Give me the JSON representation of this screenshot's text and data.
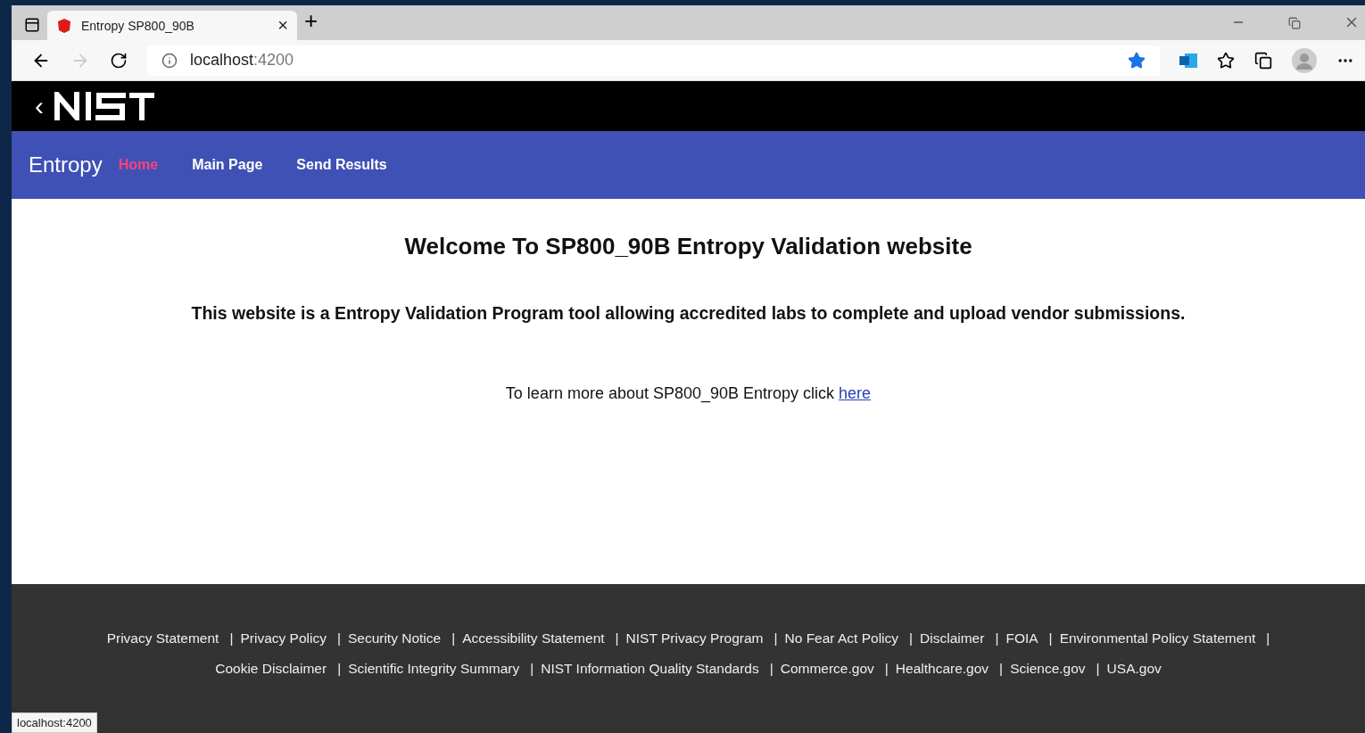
{
  "browser": {
    "tab": {
      "title": "Entropy SP800_90B",
      "close": "×",
      "selected": true
    },
    "new_tab": "+",
    "address": {
      "host": "localhost",
      "port": ":4200"
    },
    "favorite_on": true,
    "status_url": "localhost:4200"
  },
  "header": {
    "back": "‹"
  },
  "navbar": {
    "brand": "Entropy",
    "items": [
      {
        "label": "Home",
        "selected": true
      },
      {
        "label": "Main Page",
        "selected": false
      },
      {
        "label": "Send Results",
        "selected": false
      }
    ]
  },
  "content": {
    "title": "Welcome To SP800_90B Entropy Validation website",
    "subtitle": "This website is a Entropy Validation Program tool allowing accredited labs to complete and upload vendor submissions.",
    "learn_more": "To learn more about SP800_90B Entropy click",
    "link": "here"
  },
  "footer": {
    "lines": [
      {
        "links": [
          {
            "label": "Privacy Statement",
            "separator": "|"
          },
          {
            "label": "Privacy Policy",
            "separator": "|"
          },
          {
            "label": "Security Notice",
            "separator": "|"
          },
          {
            "label": "Accessibility Statement",
            "separator": "|"
          },
          {
            "label": "NIST Privacy Program",
            "separator": "|"
          },
          {
            "label": "No Fear Act Policy",
            "separator": "|"
          },
          {
            "label": "Disclaimer",
            "separator": "|"
          },
          {
            "label": "FOIA",
            "separator": "|"
          },
          {
            "label": "Environmental Policy Statement",
            "separator": "|"
          }
        ]
      },
      {
        "links": [
          {
            "label": "Cookie Disclaimer",
            "separator": "|"
          },
          {
            "label": "Scientific Integrity Summary",
            "separator": "|"
          },
          {
            "label": "NIST Information Quality Standards",
            "separator": "|"
          },
          {
            "label": "Commerce.gov",
            "separator": "|"
          },
          {
            "label": "Healthcare.gov",
            "separator": "|"
          },
          {
            "label": "Science.gov",
            "separator": "|"
          },
          {
            "label": "USA.gov"
          }
        ]
      }
    ]
  }
}
